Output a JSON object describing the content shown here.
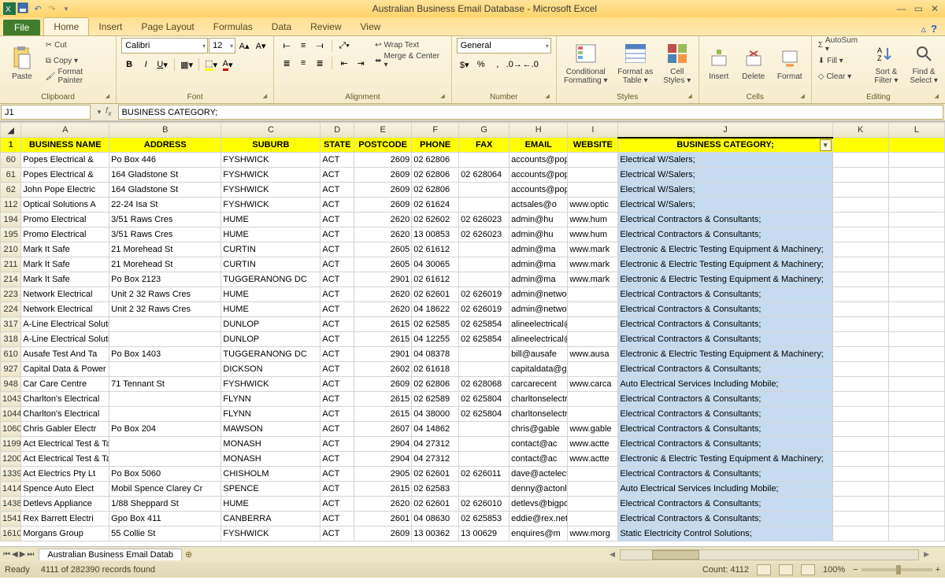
{
  "app": {
    "title": "Australian Business Email Database - Microsoft Excel"
  },
  "tabs": {
    "file": "File",
    "home": "Home",
    "insert": "Insert",
    "pagelayout": "Page Layout",
    "formulas": "Formulas",
    "data": "Data",
    "review": "Review",
    "view": "View"
  },
  "ribbon": {
    "clipboard": {
      "label": "Clipboard",
      "paste": "Paste",
      "cut": "Cut",
      "copy": "Copy ▾",
      "fmt": "Format Painter"
    },
    "font": {
      "label": "Font",
      "name": "Calibri",
      "size": "12"
    },
    "alignment": {
      "label": "Alignment",
      "wrap": "Wrap Text",
      "merge": "Merge & Center ▾"
    },
    "number": {
      "label": "Number",
      "format": "General"
    },
    "styles": {
      "label": "Styles",
      "cond": "Conditional Formatting ▾",
      "table": "Format as Table ▾",
      "cell": "Cell Styles ▾"
    },
    "cells": {
      "label": "Cells",
      "ins": "Insert",
      "del": "Delete",
      "fmt": "Format"
    },
    "editing": {
      "label": "Editing",
      "sum": "AutoSum ▾",
      "fill": "Fill ▾",
      "clear": "Clear ▾",
      "sort": "Sort & Filter ▾",
      "find": "Find & Select ▾"
    }
  },
  "namebox": "J1",
  "formula": "BUSINESS CATEGORY;",
  "colhdr": [
    "A",
    "B",
    "C",
    "D",
    "E",
    "F",
    "G",
    "H",
    "I",
    "J",
    "K",
    "L"
  ],
  "headers": {
    "A": "BUSINESS NAME",
    "B": "ADDRESS",
    "C": "SUBURB",
    "D": "STATE",
    "E": "POSTCODE",
    "F": "PHONE",
    "G": "FAX",
    "H": "EMAIL",
    "I": "WEBSITE",
    "J": "BUSINESS CATEGORY;",
    "K": "",
    "L": ""
  },
  "rows": [
    {
      "n": "60",
      "A": "Popes Electrical &",
      "B": "Po Box 446",
      "C": "FYSHWICK",
      "D": "ACT",
      "E": "2609",
      "F": "02 62806",
      "G": "",
      "H": "accounts@popeselectr",
      "I": "",
      "J": "Electrical W/Salers;"
    },
    {
      "n": "61",
      "A": "Popes Electrical &",
      "B": "164 Gladstone St",
      "C": "FYSHWICK",
      "D": "ACT",
      "E": "2609",
      "F": "02 62806",
      "G": "02 628064",
      "H": "accounts@popeselectr",
      "I": "",
      "J": "Electrical W/Salers;"
    },
    {
      "n": "62",
      "A": "John Pope Electric",
      "B": "164 Gladstone St",
      "C": "FYSHWICK",
      "D": "ACT",
      "E": "2609",
      "F": "02 62806",
      "G": "",
      "H": "accounts@popeselectr",
      "I": "",
      "J": "Electrical W/Salers;"
    },
    {
      "n": "112",
      "A": "Optical Solutions A",
      "B": "22-24 Isa St",
      "C": "FYSHWICK",
      "D": "ACT",
      "E": "2609",
      "F": "02 61624",
      "G": "",
      "H": "actsales@o",
      "I": "www.optic",
      "J": "Electrical W/Salers;"
    },
    {
      "n": "194",
      "A": "Promo Electrical",
      "B": "3/51 Raws Cres",
      "C": "HUME",
      "D": "ACT",
      "E": "2620",
      "F": "02 62602",
      "G": "02 626023",
      "H": "admin@hu",
      "I": "www.hum",
      "J": "Electrical Contractors & Consultants;"
    },
    {
      "n": "195",
      "A": "Promo Electrical",
      "B": "3/51 Raws Cres",
      "C": "HUME",
      "D": "ACT",
      "E": "2620",
      "F": "13 00853",
      "G": "02 626023",
      "H": "admin@hu",
      "I": "www.hum",
      "J": "Electrical Contractors & Consultants;"
    },
    {
      "n": "210",
      "A": "Mark It Safe",
      "B": "21 Morehead St",
      "C": "CURTIN",
      "D": "ACT",
      "E": "2605",
      "F": "02 61612",
      "G": "",
      "H": "admin@ma",
      "I": "www.mark",
      "J": "Electronic & Electric Testing Equipment & Machinery;"
    },
    {
      "n": "211",
      "A": "Mark It Safe",
      "B": "21 Morehead St",
      "C": "CURTIN",
      "D": "ACT",
      "E": "2605",
      "F": "04 30065",
      "G": "",
      "H": "admin@ma",
      "I": "www.mark",
      "J": "Electronic & Electric Testing Equipment & Machinery;"
    },
    {
      "n": "214",
      "A": "Mark It Safe",
      "B": "Po Box 2123",
      "C": "TUGGERANONG DC",
      "D": "ACT",
      "E": "2901",
      "F": "02 61612",
      "G": "",
      "H": "admin@ma",
      "I": "www.mark",
      "J": "Electronic & Electric Testing Equipment & Machinery;"
    },
    {
      "n": "223",
      "A": "Network Electrical",
      "B": "Unit 2 32 Raws Cres",
      "C": "HUME",
      "D": "ACT",
      "E": "2620",
      "F": "02 62601",
      "G": "02 626019",
      "H": "admin@networkelectr",
      "I": "",
      "J": "Electrical Contractors & Consultants;"
    },
    {
      "n": "224",
      "A": "Network Electrical",
      "B": "Unit 2 32 Raws Cres",
      "C": "HUME",
      "D": "ACT",
      "E": "2620",
      "F": "04 18622",
      "G": "02 626019",
      "H": "admin@networkelectr",
      "I": "",
      "J": "Electrical Contractors & Consultants;"
    },
    {
      "n": "317",
      "A": "A-Line Electrical Solutions",
      "B": "",
      "C": "DUNLOP",
      "D": "ACT",
      "E": "2615",
      "F": "02 62585",
      "G": "02 625854",
      "H": "alineelectrical@intern",
      "I": "",
      "J": "Electrical Contractors & Consultants;"
    },
    {
      "n": "318",
      "A": "A-Line Electrical Solutions",
      "B": "",
      "C": "DUNLOP",
      "D": "ACT",
      "E": "2615",
      "F": "04 12255",
      "G": "02 625854",
      "H": "alineelectrical@intern",
      "I": "",
      "J": "Electrical Contractors & Consultants;"
    },
    {
      "n": "610",
      "A": "Ausafe Test And Ta",
      "B": "Po Box 1403",
      "C": "TUGGERANONG DC",
      "D": "ACT",
      "E": "2901",
      "F": "04 08378",
      "G": "",
      "H": "bill@ausafe",
      "I": "www.ausa",
      "J": "Electronic & Electric Testing Equipment & Machinery;"
    },
    {
      "n": "927",
      "A": "Capital Data & Power Pty Ltd",
      "B": "",
      "C": "DICKSON",
      "D": "ACT",
      "E": "2602",
      "F": "02 61618",
      "G": "",
      "H": "capitaldata@grapevin",
      "I": "",
      "J": "Electrical Contractors & Consultants;"
    },
    {
      "n": "948",
      "A": "Car Care Centre",
      "B": "71 Tennant St",
      "C": "FYSHWICK",
      "D": "ACT",
      "E": "2609",
      "F": "02 62806",
      "G": "02 628068",
      "H": "carcarecent",
      "I": "www.carca",
      "J": "Auto Electrical Services Including Mobile;"
    },
    {
      "n": "1043",
      "A": "Charlton's Electrical",
      "B": "",
      "C": "FLYNN",
      "D": "ACT",
      "E": "2615",
      "F": "02 62589",
      "G": "02 625804",
      "H": "charltonselectrical@bi",
      "I": "",
      "J": "Electrical Contractors & Consultants;"
    },
    {
      "n": "1044",
      "A": "Charlton's Electrical",
      "B": "",
      "C": "FLYNN",
      "D": "ACT",
      "E": "2615",
      "F": "04 38000",
      "G": "02 625804",
      "H": "charltonselectrical@bi",
      "I": "",
      "J": "Electrical Contractors & Consultants;"
    },
    {
      "n": "1060",
      "A": "Chris Gabler Electr",
      "B": "Po Box 204",
      "C": "MAWSON",
      "D": "ACT",
      "E": "2607",
      "F": "04 14862",
      "G": "",
      "H": "chris@gable",
      "I": "www.gable",
      "J": "Electrical Contractors & Consultants;"
    },
    {
      "n": "1199",
      "A": "Act Electrical Test & Tag",
      "B": "",
      "C": "MONASH",
      "D": "ACT",
      "E": "2904",
      "F": "04 27312",
      "G": "",
      "H": "contact@ac",
      "I": "www.actte",
      "J": "Electrical Contractors & Consultants;"
    },
    {
      "n": "1200",
      "A": "Act Electrical Test & Tag",
      "B": "",
      "C": "MONASH",
      "D": "ACT",
      "E": "2904",
      "F": "04 27312",
      "G": "",
      "H": "contact@ac",
      "I": "www.actte",
      "J": "Electronic & Electric Testing Equipment & Machinery;"
    },
    {
      "n": "1339",
      "A": "Act Electrics Pty Lt",
      "B": "Po Box 5060",
      "C": "CHISHOLM",
      "D": "ACT",
      "E": "2905",
      "F": "02 62601",
      "G": "02 626011",
      "H": "dave@actelectrics.com",
      "I": "",
      "J": "Electrical Contractors & Consultants;"
    },
    {
      "n": "1414",
      "A": "Spence Auto Elect",
      "B": "Mobil Spence Clarey Cr",
      "C": "SPENCE",
      "D": "ACT",
      "E": "2615",
      "F": "02 62583",
      "G": "",
      "H": "denny@actonline.com",
      "I": "",
      "J": "Auto Electrical Services Including Mobile;"
    },
    {
      "n": "1438",
      "A": "Detlevs Appliance",
      "B": "1/88 Sheppard St",
      "C": "HUME",
      "D": "ACT",
      "E": "2620",
      "F": "02 62601",
      "G": "02 626010",
      "H": "detlevs@bigpond.com",
      "I": "",
      "J": "Electrical Contractors & Consultants;"
    },
    {
      "n": "1541",
      "A": "Rex Barrett Electri",
      "B": "Gpo Box 411",
      "C": "CANBERRA",
      "D": "ACT",
      "E": "2601",
      "F": "04 08630",
      "G": "02 625853",
      "H": "eddie@rex.net.au",
      "I": "",
      "J": "Electrical Contractors & Consultants;"
    },
    {
      "n": "1610",
      "A": "Morgans Group",
      "B": "55 Collie St",
      "C": "FYSHWICK",
      "D": "ACT",
      "E": "2609",
      "F": "13 00362",
      "G": "13 00629",
      "H": "enquires@m",
      "I": "www.morg",
      "J": "Static Electricity Control Solutions;"
    }
  ],
  "sheet": {
    "name": "Australian Business Email Datab"
  },
  "status": {
    "ready": "Ready",
    "filter": "4111 of 282390 records found",
    "count": "Count: 4112",
    "zoom": "100%"
  }
}
